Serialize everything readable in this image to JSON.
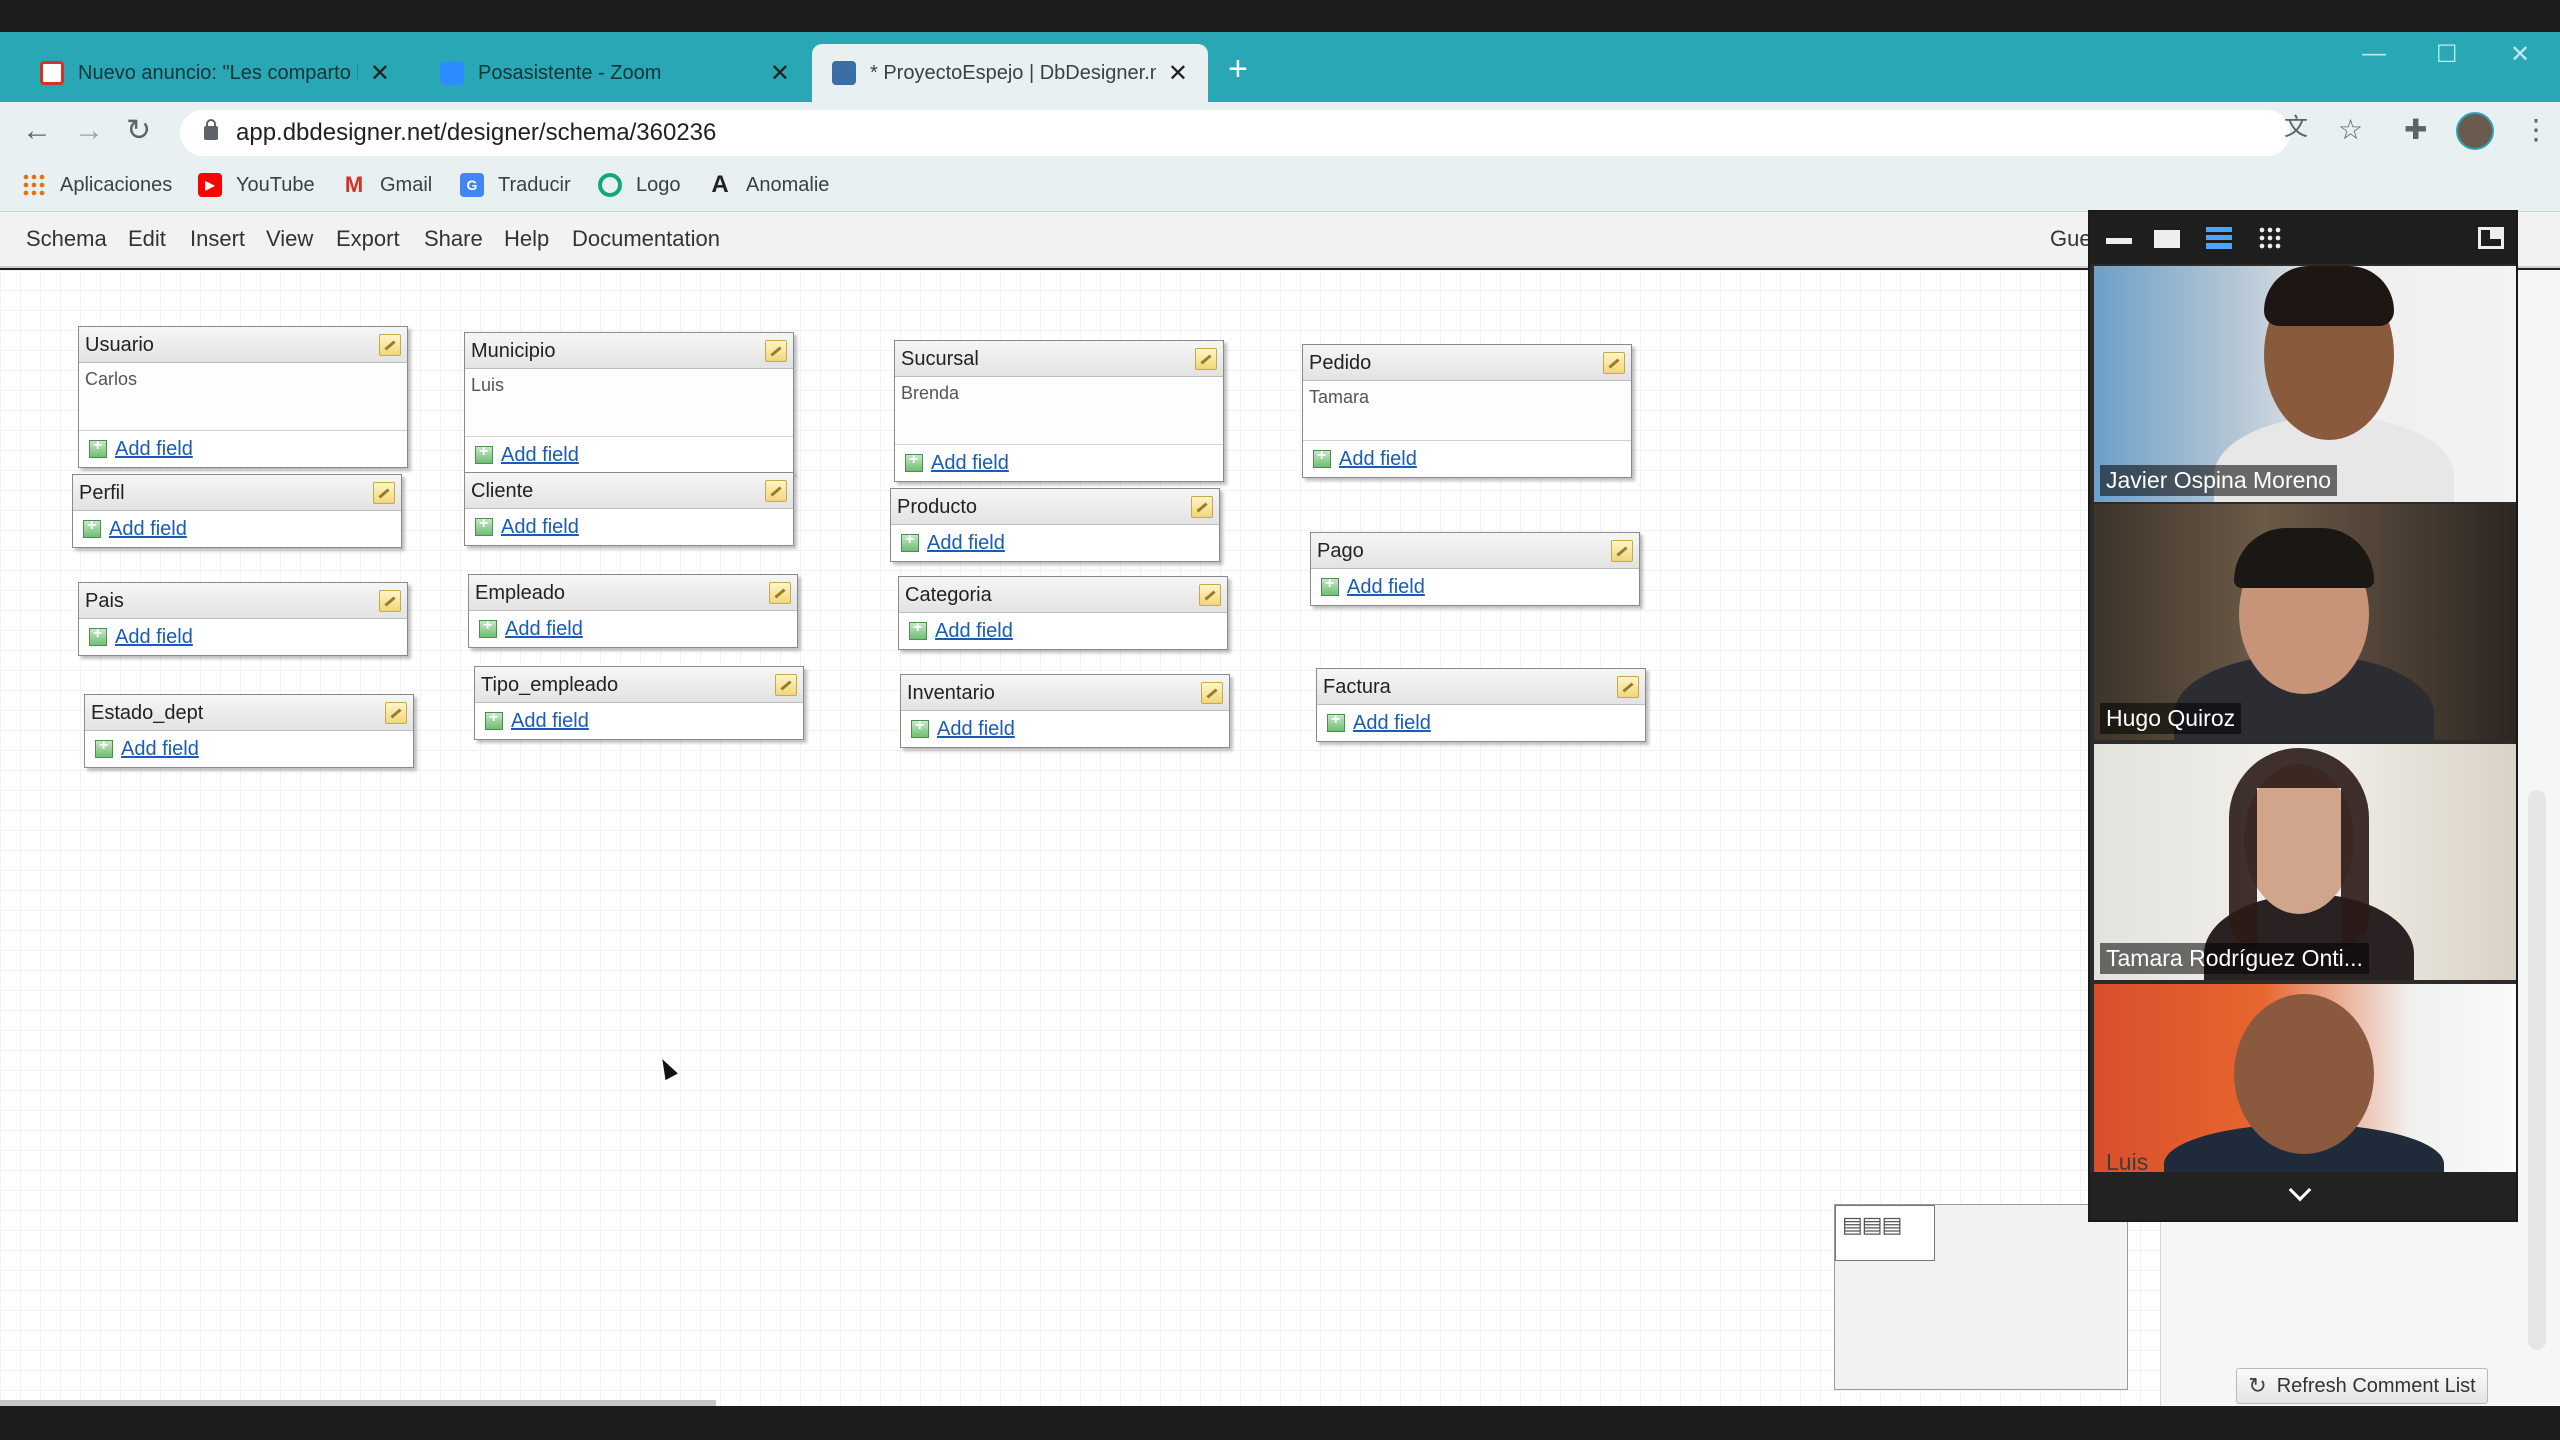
{
  "browser": {
    "tabs": [
      {
        "title": "Nuevo anuncio: \"Les comparto l",
        "favicon_color": "#d93025"
      },
      {
        "title": "Posasistente - Zoom",
        "favicon_color": "#2d8cff"
      },
      {
        "title": "* ProyectoEspejo | DbDesigner.n",
        "favicon_color": "#3a6ea5"
      }
    ],
    "url": "app.dbdesigner.net/designer/schema/360236",
    "bookmarks": [
      {
        "label": "Aplicaciones",
        "icon": "apps-grid-icon"
      },
      {
        "label": "YouTube",
        "icon": "youtube-icon"
      },
      {
        "label": "Gmail",
        "icon": "gmail-icon"
      },
      {
        "label": "Traducir",
        "icon": "translate-icon"
      },
      {
        "label": "Logo",
        "icon": "logo-icon"
      },
      {
        "label": "Anomalie",
        "icon": "anomalie-icon"
      }
    ]
  },
  "app": {
    "menu": [
      "Schema",
      "Edit",
      "Insert",
      "View",
      "Export",
      "Share",
      "Help",
      "Documentation"
    ],
    "guest_label": "Gue",
    "add_field_label": "Add field",
    "refresh_label": "Refresh Comment List"
  },
  "tables": [
    {
      "name": "Usuario",
      "note": "Carlos"
    },
    {
      "name": "Perfil",
      "note": ""
    },
    {
      "name": "Pais",
      "note": ""
    },
    {
      "name": "Estado_dept",
      "note": ""
    },
    {
      "name": "Municipio",
      "note": "Luis"
    },
    {
      "name": "Cliente",
      "note": ""
    },
    {
      "name": "Empleado",
      "note": ""
    },
    {
      "name": "Tipo_empleado",
      "note": ""
    },
    {
      "name": "Sucursal",
      "note": "Brenda"
    },
    {
      "name": "Producto",
      "note": ""
    },
    {
      "name": "Categoria",
      "note": ""
    },
    {
      "name": "Inventario",
      "note": ""
    },
    {
      "name": "Pedido",
      "note": "Tamara"
    },
    {
      "name": "Pago",
      "note": ""
    },
    {
      "name": "Factura",
      "note": ""
    }
  ],
  "zoom": {
    "participants": [
      {
        "name": "Javier Ospina Moreno"
      },
      {
        "name": "Hugo Quiroz"
      },
      {
        "name": "Tamara Rodríguez Onti..."
      },
      {
        "name": "Luis"
      }
    ]
  }
}
